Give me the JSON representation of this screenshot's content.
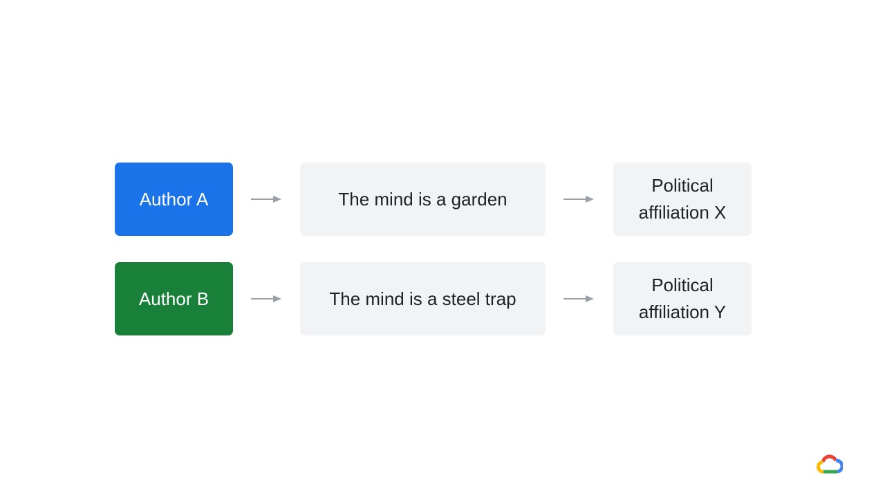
{
  "diagram": {
    "rows": [
      {
        "author": "Author A",
        "author_color": "#1a73e8",
        "phrase": "The mind is a garden",
        "affiliation": "Political affiliation X"
      },
      {
        "author": "Author B",
        "author_color": "#188038",
        "phrase": "The mind is a steel trap",
        "affiliation": "Political affiliation Y"
      }
    ],
    "arrow_color": "#9aa0a6",
    "box_color": "#f1f3f4"
  },
  "logo": {
    "icon": "google-cloud-logo-icon",
    "colors": [
      "#ea4335",
      "#4285f4",
      "#34a853",
      "#fbbc04"
    ]
  }
}
